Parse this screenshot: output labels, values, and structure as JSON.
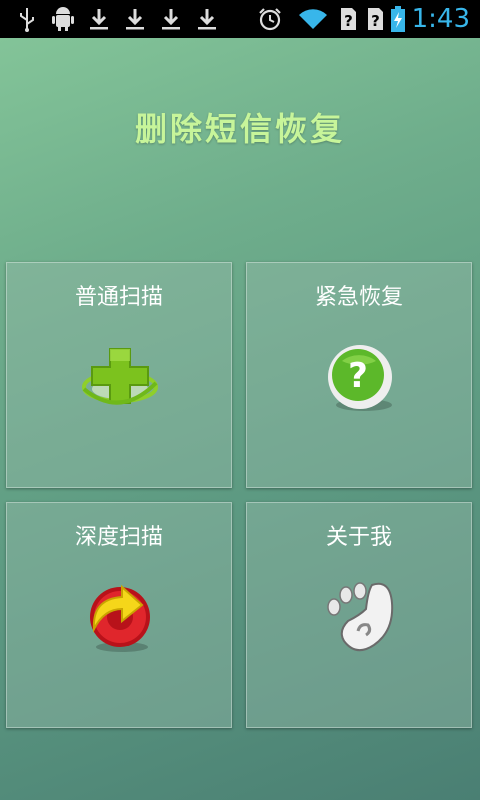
{
  "status_bar": {
    "time": "1:43",
    "icons": [
      "usb-icon",
      "android-debug-icon",
      "download-icon",
      "download-icon",
      "download-icon",
      "download-icon",
      "alarm-icon",
      "wifi-icon",
      "sim-unknown-icon",
      "sim-unknown-icon",
      "battery-charging-icon"
    ],
    "time_color": "#38b6ea"
  },
  "app": {
    "title": "删除短信恢复",
    "title_color": "#c7f59a"
  },
  "tiles": [
    {
      "label": "普通扫描",
      "icon": "green-cross-icon"
    },
    {
      "label": "紧急恢复",
      "icon": "question-icon"
    },
    {
      "label": "深度扫描",
      "icon": "refresh-arrow-icon"
    },
    {
      "label": "关于我",
      "icon": "foot-icon"
    }
  ]
}
